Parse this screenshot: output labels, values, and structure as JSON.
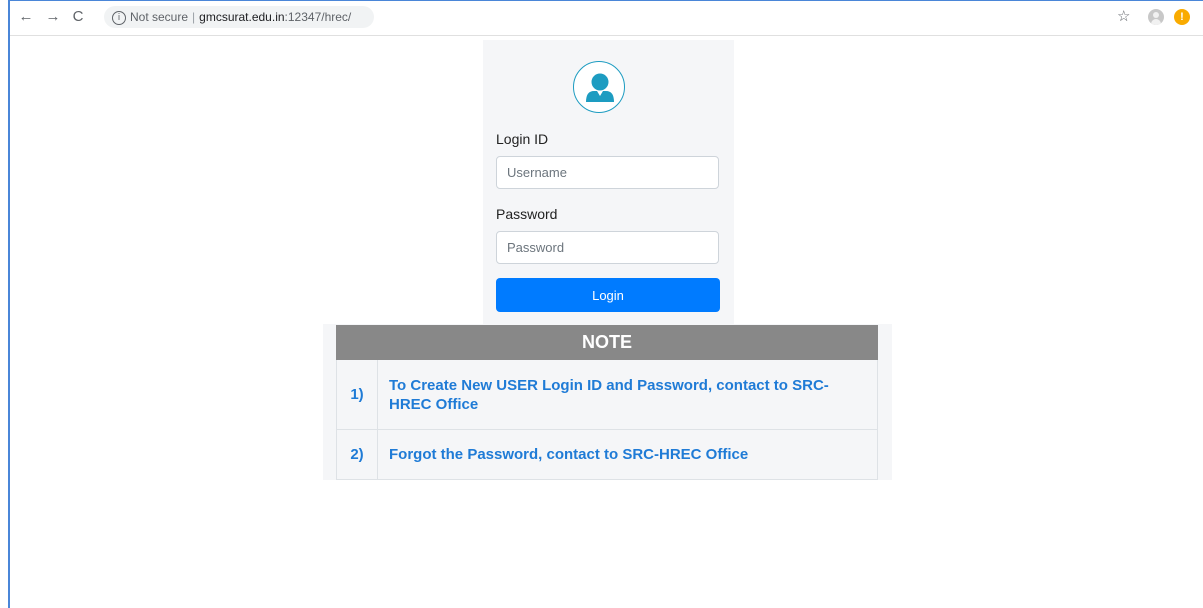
{
  "browser": {
    "back_icon": "arrow-left-icon",
    "forward_icon": "arrow-right-icon",
    "reload_icon": "reload-icon",
    "security_icon": "info-icon",
    "security_label": "Not secure",
    "url_host": "gmcsurat.edu.in",
    "url_rest": ":12347/hrec/",
    "bookmark_icon": "star-icon",
    "profile_icon": "profile-icon",
    "alert_icon": "alert-icon"
  },
  "login": {
    "avatar_icon": "user-icon",
    "login_id_label": "Login ID",
    "username_placeholder": "Username",
    "username_value": "",
    "password_label": "Password",
    "password_placeholder": "Password",
    "password_value": "",
    "login_button_label": "Login",
    "accent_color": "#007bff",
    "avatar_color": "#1d9cc1"
  },
  "note": {
    "title": "NOTE",
    "header_color": "#888888",
    "text_color": "#1f7bd6",
    "items": [
      {
        "number": "1)",
        "text": "To Create New USER Login ID and Password, contact to SRC-HREC Office"
      },
      {
        "number": "2)",
        "text": "Forgot the Password, contact to SRC-HREC Office"
      }
    ]
  }
}
